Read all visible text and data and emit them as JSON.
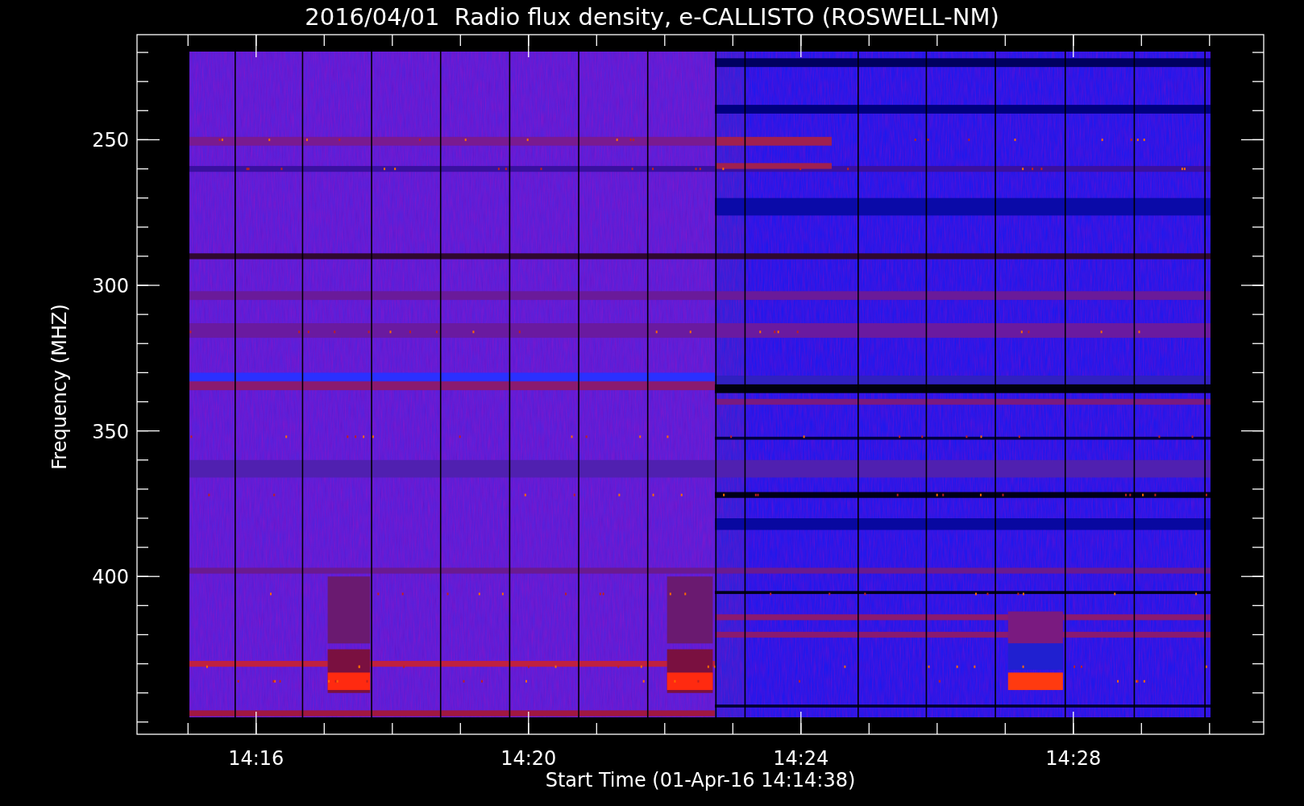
{
  "chart": {
    "title": "2016/04/01  Radio flux density, e-CALLISTO (ROSWELL-NM)",
    "xlabel": "Start Time (01-Apr-16 14:14:38)",
    "ylabel": "Frequency (MHZ)",
    "xticks": [
      "14:16",
      "14:20",
      "14:24",
      "14:28"
    ],
    "yticks": [
      "250",
      "300",
      "350",
      "400"
    ]
  }
}
